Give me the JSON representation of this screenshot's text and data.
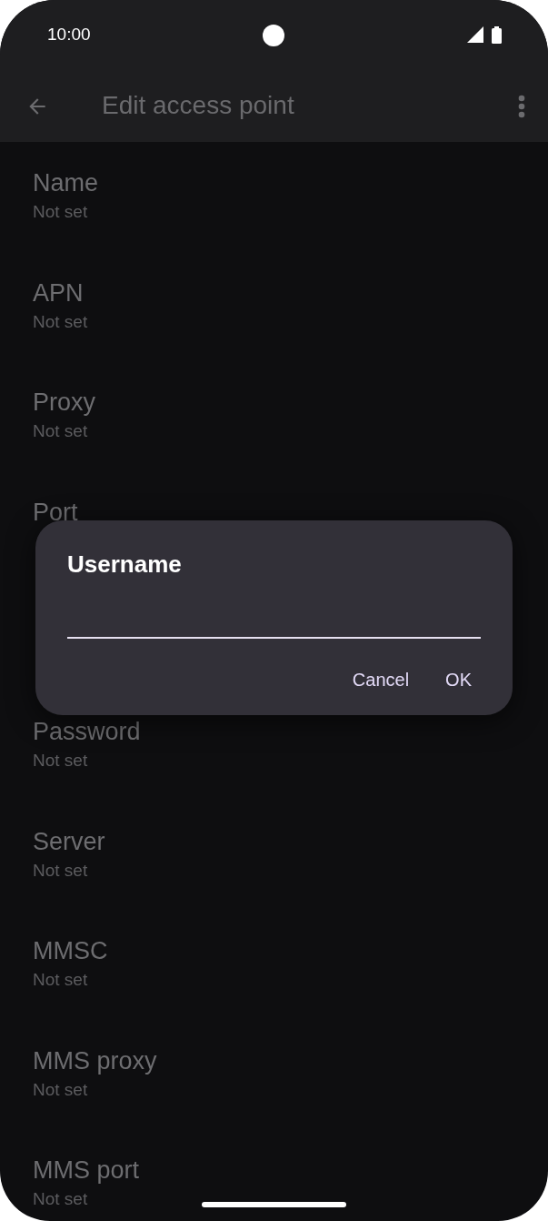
{
  "status_bar": {
    "time": "10:00"
  },
  "app_bar": {
    "title": "Edit access point"
  },
  "settings": [
    {
      "kind": "setting",
      "title": "Name",
      "subtitle": "Not set"
    },
    {
      "kind": "setting",
      "title": "APN",
      "subtitle": "Not set"
    },
    {
      "kind": "setting",
      "title": "Proxy",
      "subtitle": "Not set"
    },
    {
      "kind": "setting",
      "title": "Port"
    },
    {
      "kind": "covered"
    },
    {
      "kind": "setting",
      "title": "Password",
      "subtitle": "Not set"
    },
    {
      "kind": "setting",
      "title": "Server",
      "subtitle": "Not set"
    },
    {
      "kind": "setting",
      "title": "MMSC",
      "subtitle": "Not set"
    },
    {
      "kind": "setting",
      "title": "MMS proxy",
      "subtitle": "Not set"
    },
    {
      "kind": "setting",
      "title": "MMS port",
      "subtitle": "Not set"
    }
  ],
  "dialog": {
    "title": "Username",
    "buttons": [
      "Cancel",
      "OK"
    ]
  }
}
